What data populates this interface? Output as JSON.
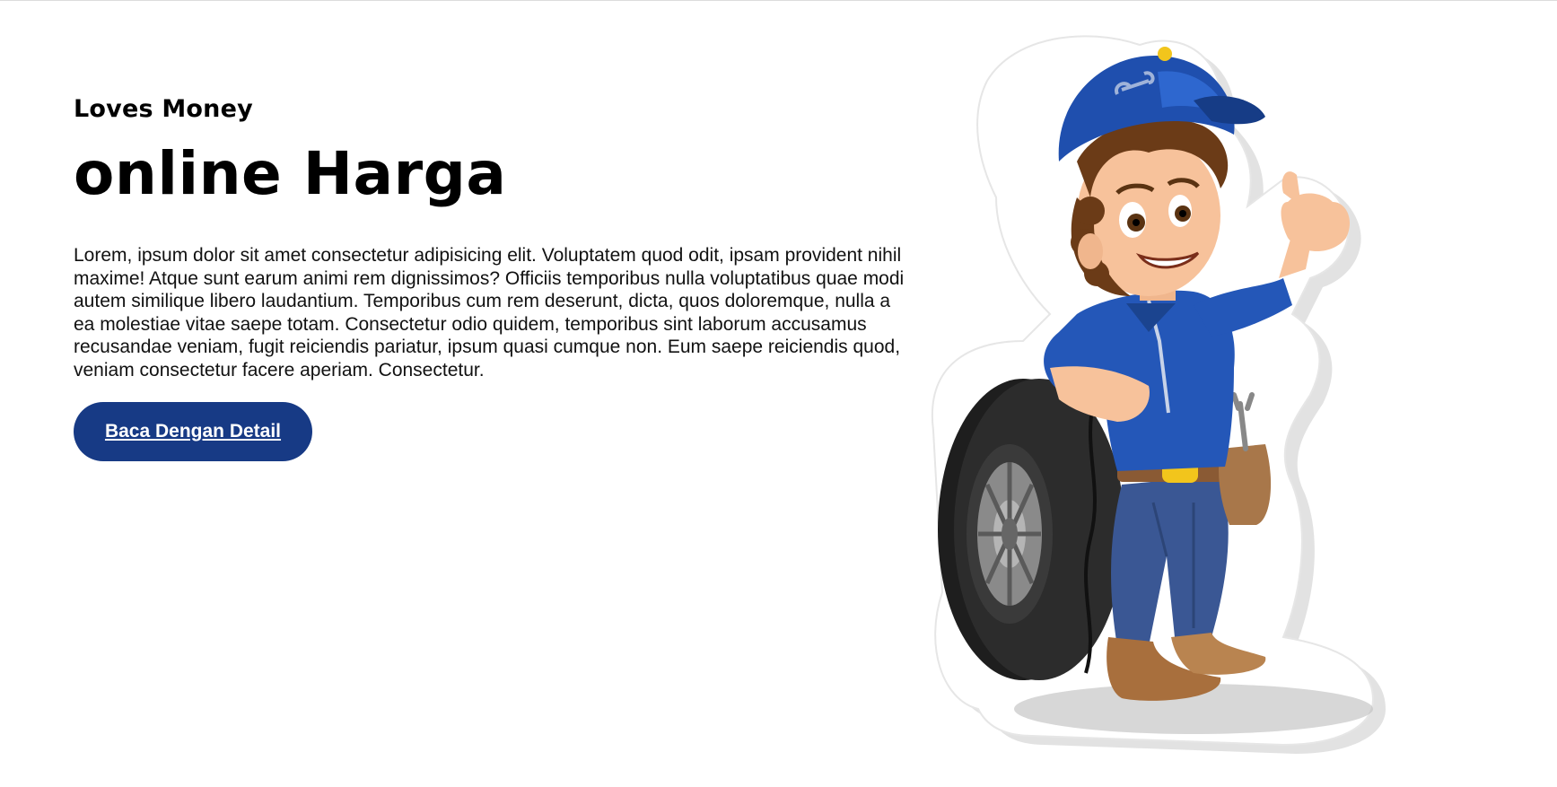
{
  "hero": {
    "eyebrow": "Loves Money",
    "headline": "online Harga",
    "body": "Lorem, ipsum dolor sit amet consectetur adipisicing elit. Voluptatem quod odit, ipsam provident nihil maxime! Atque sunt earum animi rem dignissimos? Officiis temporibus nulla voluptatibus quae modi autem similique libero laudantium. Temporibus cum rem deserunt, dicta, quos doloremque, nulla a ea molestiae vitae saepe totam. Consectetur odio quidem, temporibus sint laborum accusamus recusandae veniam, fugit reiciendis pariatur, ipsum quasi cumque non. Eum saepe reiciendis quod, veniam consectetur facere aperiam. Consectetur.",
    "cta_label": "Baca Dengan Detail"
  },
  "illustration": {
    "icon": "mechanic-boy-illustration",
    "colors": {
      "cap": "#1f4fae",
      "shirt": "#2457b8",
      "jeans": "#3a5794",
      "tire": "#2a2a2a",
      "skin": "#f7c29b",
      "hair": "#6b3b17",
      "boots": "#b07a4a"
    }
  },
  "colors": {
    "button_bg": "#173a85",
    "button_text": "#ffffff",
    "text": "#000000"
  }
}
